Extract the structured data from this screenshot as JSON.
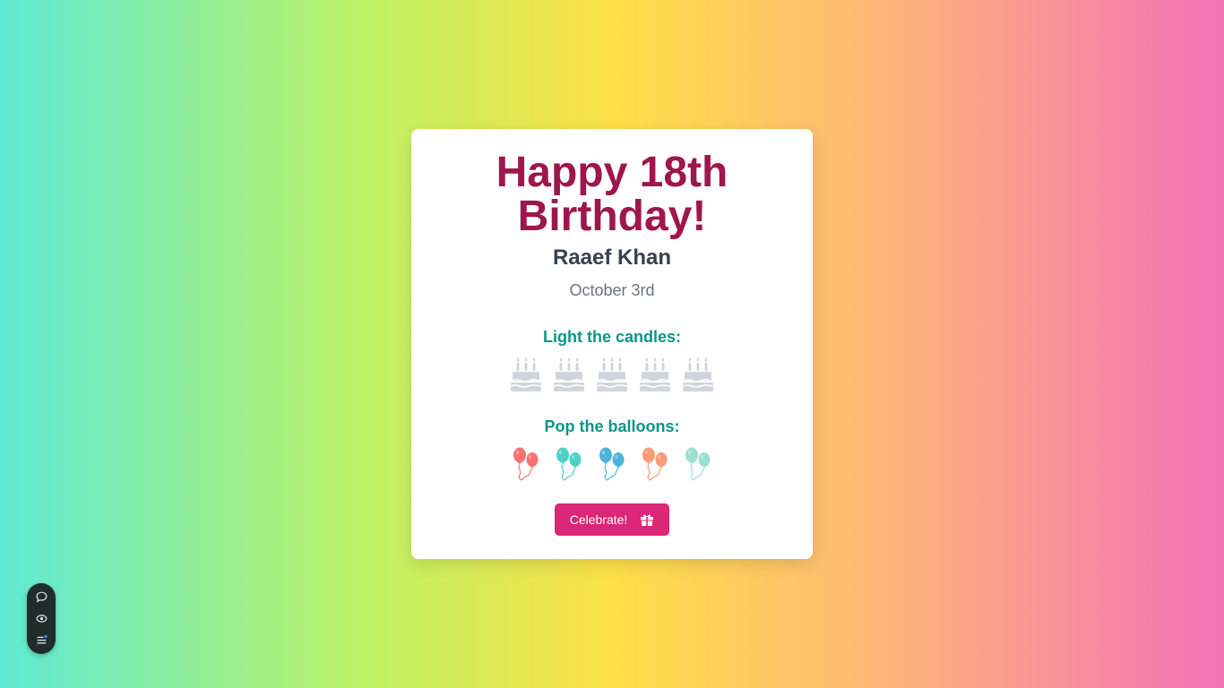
{
  "card": {
    "title": "Happy 18th Birthday!",
    "name": "Raaef Khan",
    "date": "October 3rd",
    "candles_label": "Light the candles:",
    "balloons_label": "Pop the balloons:",
    "celebrate_label": "Celebrate!"
  },
  "candles": [
    {
      "icon": "birthday-cake-icon",
      "color": "#d1d5db",
      "lit": false
    },
    {
      "icon": "birthday-cake-icon",
      "color": "#d1d5db",
      "lit": false
    },
    {
      "icon": "birthday-cake-icon",
      "color": "#d1d5db",
      "lit": false
    },
    {
      "icon": "birthday-cake-icon",
      "color": "#d1d5db",
      "lit": false
    },
    {
      "icon": "birthday-cake-icon",
      "color": "#d1d5db",
      "lit": false
    }
  ],
  "balloons": [
    {
      "icon": "balloons-icon",
      "color": "#f87171"
    },
    {
      "icon": "balloons-icon",
      "color": "#4fd1c5"
    },
    {
      "icon": "balloons-icon",
      "color": "#4fb3d9"
    },
    {
      "icon": "balloons-icon",
      "color": "#fb9a74"
    },
    {
      "icon": "balloons-icon",
      "color": "#99e0cf"
    }
  ],
  "colors": {
    "title": "#9d174d",
    "name": "#374151",
    "date": "#6b7280",
    "section_label": "#0d9488",
    "button": "#db2777",
    "widget": "#1f2d2b"
  },
  "widget": {
    "buttons": [
      "chat-bubble-icon",
      "eye-icon",
      "menu-list-icon"
    ]
  }
}
